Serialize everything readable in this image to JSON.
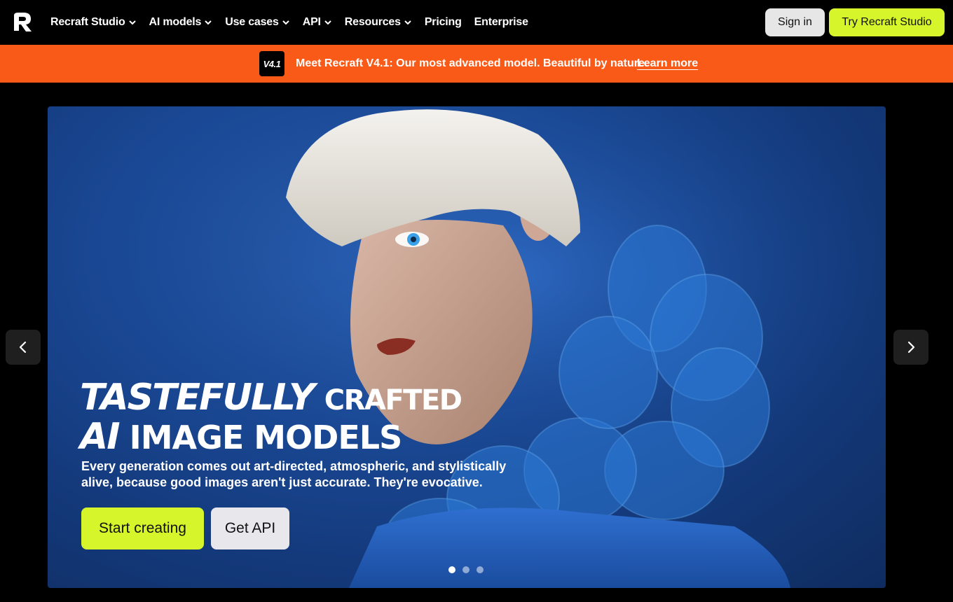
{
  "nav": {
    "logo_icon": "recraft-logo-icon",
    "items": [
      {
        "label": "Recraft Studio",
        "has_dropdown": true
      },
      {
        "label": "AI models",
        "has_dropdown": true
      },
      {
        "label": "Use cases",
        "has_dropdown": true
      },
      {
        "label": "API",
        "has_dropdown": true
      },
      {
        "label": "Resources",
        "has_dropdown": true
      },
      {
        "label": "Pricing",
        "has_dropdown": false
      },
      {
        "label": "Enterprise",
        "has_dropdown": false
      }
    ],
    "signin_label": "Sign in",
    "try_label": "Try Recraft Studio"
  },
  "banner": {
    "badge": "V4.1",
    "text": "Meet Recraft V4.1: Our most advanced model. Beautiful by nature.",
    "link": "Learn more",
    "color": "#fa5a18"
  },
  "hero": {
    "title_word1": "TASTEFULLY",
    "title_word2": "CRAFTED",
    "title_word3": "AI",
    "title_word4": "IMAGE MODELS",
    "subtitle": "Every generation comes out art-directed, atmospheric, and stylistically alive, because good images aren't just accurate. They're evocative.",
    "start_label": "Start creating",
    "api_label": "Get API",
    "slide_count": 3,
    "active_slide": 1
  },
  "colors": {
    "accent": "#d6f52a",
    "background": "#000000"
  },
  "icons": {
    "prev": "chevron-left-icon",
    "next": "chevron-right-icon",
    "dropdown": "chevron-down-icon"
  }
}
